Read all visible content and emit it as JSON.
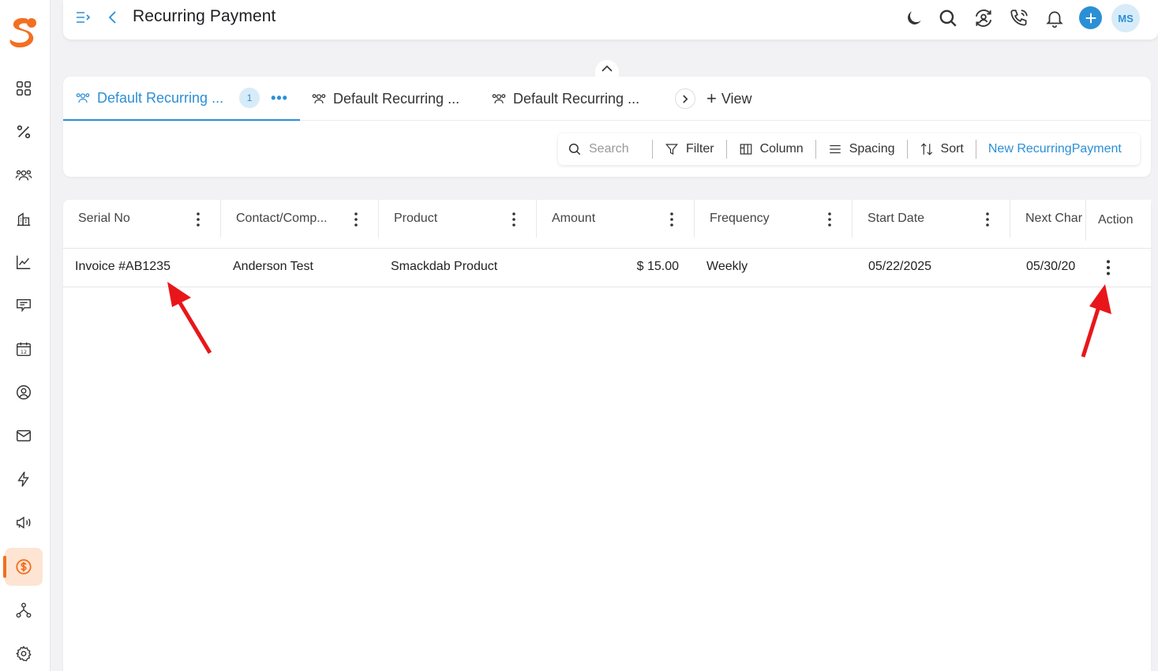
{
  "header": {
    "title": "Recurring Payment",
    "avatar_initials": "MS"
  },
  "views": {
    "tabs": [
      {
        "label": "Default Recurring ...",
        "badge": "1",
        "active": true
      },
      {
        "label": "Default Recurring ...",
        "active": false
      },
      {
        "label": "Default Recurring ...",
        "active": false
      }
    ],
    "more": "•••",
    "add_view_label": "View"
  },
  "toolbar": {
    "search_placeholder": "Search",
    "filter": "Filter",
    "column": "Column",
    "spacing": "Spacing",
    "sort": "Sort",
    "new_record": "New RecurringPayment"
  },
  "table": {
    "columns": [
      "Serial No",
      "Contact/Comp...",
      "Product",
      "Amount",
      "Frequency",
      "Start Date",
      "Next Char"
    ],
    "action_header": "Action",
    "rows": [
      {
        "serial_no": "Invoice #AB1235",
        "contact": "Anderson Test",
        "product": "Smackdab Product",
        "amount": "$ 15.00",
        "frequency": "Weekly",
        "start_date": "05/22/2025",
        "next_charge": "05/30/20"
      }
    ]
  },
  "colors": {
    "accent": "#2b8fd6",
    "brand": "#f36f21",
    "annotation_arrow": "#e8161a"
  }
}
